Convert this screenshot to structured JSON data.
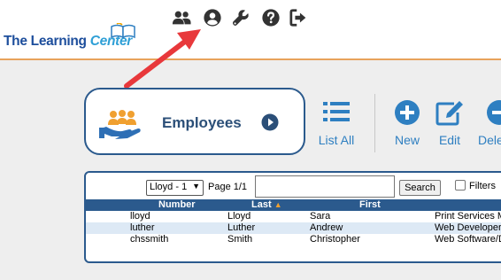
{
  "header": {
    "logo_text_main": "The Learning",
    "logo_text_accent": "Center",
    "icons": [
      "users-icon",
      "user-circle-icon",
      "wrench-icon",
      "question-circle-icon",
      "sign-out-icon"
    ]
  },
  "card": {
    "title": "Employees"
  },
  "toolbar": {
    "list_all": "List All",
    "new": "New",
    "edit": "Edit",
    "delete": "Dele"
  },
  "table_controls": {
    "selector_value": "Lloyd - 1",
    "page_text": "Page 1/1",
    "search_value": "",
    "search_button": "Search",
    "filters_label": "Filters"
  },
  "table": {
    "columns": [
      "Number",
      "Last",
      "First"
    ],
    "rows": [
      {
        "number": "lloyd",
        "last": "Lloyd",
        "first": "Sara",
        "title": "Print Services M"
      },
      {
        "number": "luther",
        "last": "Luther",
        "first": "Andrew",
        "title": "Web Developer"
      },
      {
        "number": "chssmith",
        "last": "Smith",
        "first": "Christopher",
        "title": "Web Software/D"
      }
    ]
  },
  "colors": {
    "accent_blue": "#2b5a8d",
    "link_blue": "#2e7fc1",
    "annotation_arrow": "#e8383b",
    "header_rule": "#e8a35c"
  }
}
